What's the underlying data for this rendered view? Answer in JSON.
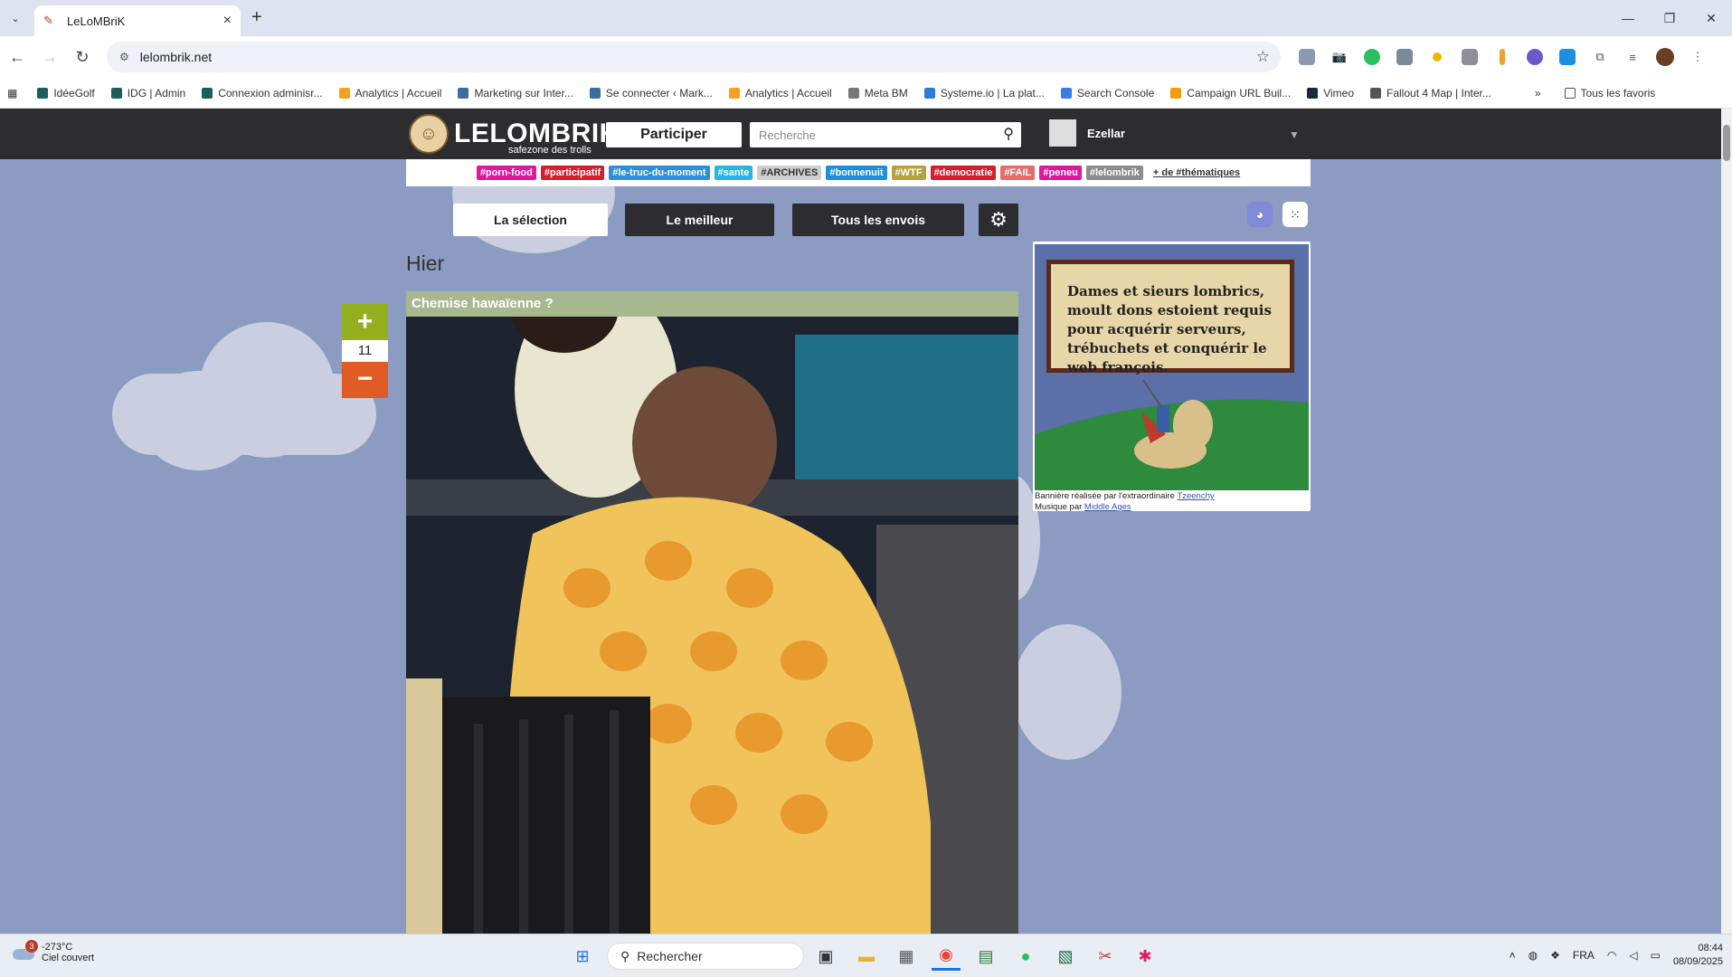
{
  "browser": {
    "tab_title": "LeLoMBriK",
    "url": "lelombrik.net",
    "bookmarks": [
      {
        "label": "IdéeGolf",
        "color": "#1b5e5a"
      },
      {
        "label": "IDG | Admin",
        "color": "#1b5e5a"
      },
      {
        "label": "Connexion adminisr...",
        "color": "#1b5e5a"
      },
      {
        "label": "Analytics | Accueil",
        "color": "#f4a020"
      },
      {
        "label": "Marketing sur Inter...",
        "color": "#3c6e9f"
      },
      {
        "label": "Se connecter ‹ Mark...",
        "color": "#3c6e9f"
      },
      {
        "label": "Analytics | Accueil",
        "color": "#f4a020"
      },
      {
        "label": "Meta BM",
        "color": "#777777"
      },
      {
        "label": "Systeme.io | La plat...",
        "color": "#2d7bd8"
      },
      {
        "label": "Search Console",
        "color": "#3b7ce0"
      },
      {
        "label": "Campaign URL Buil...",
        "color": "#f39c12"
      },
      {
        "label": "Vimeo",
        "color": "#1a2b3c"
      },
      {
        "label": "Fallout 4 Map | Inter...",
        "color": "#555555"
      }
    ],
    "all_bookmarks": "Tous les favoris"
  },
  "site": {
    "logo_name": "LELOMBRIK",
    "logo_sub": "safezone des trolls",
    "participer": "Participer",
    "search_placeholder": "Recherche",
    "username": "Ezellar",
    "tags": [
      {
        "label": "#porn-food",
        "color": "#e0189a"
      },
      {
        "label": "#participatif",
        "color": "#d81e2e"
      },
      {
        "label": "#le-truc-du-moment",
        "color": "#2e8fd6"
      },
      {
        "label": "#sante",
        "color": "#27b6e0"
      },
      {
        "label": "#ARCHIVES",
        "color": "#cfcfcf"
      },
      {
        "label": "#bonnenuit",
        "color": "#1f8ed6"
      },
      {
        "label": "#WTF",
        "color": "#b6a23c"
      },
      {
        "label": "#democratie",
        "color": "#d81e2e"
      },
      {
        "label": "#FAIL",
        "color": "#e96a6a"
      },
      {
        "label": "#peneu",
        "color": "#e0189a"
      },
      {
        "label": "#lelombrik",
        "color": "#8c8c8c"
      }
    ],
    "more_tags": "+ de #thématiques",
    "nav": {
      "selection": "La sélection",
      "best": "Le meilleur",
      "all": "Tous les envois"
    },
    "section_title": "Hier",
    "post": {
      "title": "Chemise hawaïenne ?",
      "score": "11",
      "plus": "+",
      "minus": "−"
    },
    "banner": {
      "text": "Dames et sieurs lombrics, moult dons estoient requis pour acquérir serveurs, trébuchets et conquérir le web françois.",
      "caption_pre": "Bannière réalisée par l'extraordinaire ",
      "caption_link": "Tzeenchy",
      "music_pre": "Musique par ",
      "music_link": "Middle Ages"
    }
  },
  "taskbar": {
    "temp": "-273°C",
    "weather": "Ciel couvert",
    "weather_badge": "3",
    "search_label": "Rechercher",
    "lang": "FRA",
    "time": "08:44",
    "date": "08/09/2025"
  }
}
